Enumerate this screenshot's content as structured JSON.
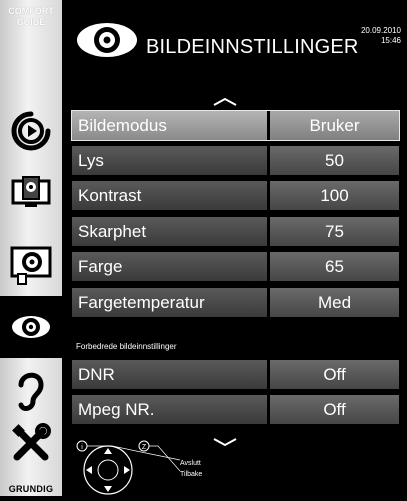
{
  "sidebar": {
    "comfort_guide_label_1": "COMFORT",
    "comfort_guide_label_2": "GUIDE",
    "brand": "GRUNDIG",
    "icons": [
      "play-source-icon",
      "tv-settings-icon",
      "install-icon",
      "picture-eye-icon",
      "sound-ear-icon",
      "tools-icon"
    ],
    "active_icon": "picture-eye-icon"
  },
  "header": {
    "title": "BILDEINNSTILLINGER",
    "date": "20.09.2010",
    "time": "15:46",
    "icon": "eye-icon"
  },
  "menu": {
    "rows": [
      {
        "label": "Bildemodus",
        "value": "Bruker",
        "selected": true
      },
      {
        "label": "Lys",
        "value": "50",
        "selected": false
      },
      {
        "label": "Kontrast",
        "value": "100",
        "selected": false
      },
      {
        "label": "Skarphet",
        "value": "75",
        "selected": false
      },
      {
        "label": "Farge",
        "value": "65",
        "selected": false
      },
      {
        "label": "Fargetemperatur",
        "value": "Med",
        "selected": false
      }
    ],
    "section_label": "Forbedrede bildeinnstillinger",
    "advanced_rows": [
      {
        "label": "DNR",
        "value": "Off"
      },
      {
        "label": "Mpeg NR.",
        "value": "Off"
      }
    ]
  },
  "footer": {
    "exit_label": "Avslutt",
    "back_label": "Tilbake",
    "exit_key": "i",
    "back_key": "Z"
  },
  "colors": {
    "background": "#000000",
    "sidebar": "#e6e6e6",
    "row_label": "#4a4a4a",
    "row_value": "#5a5a5a",
    "selected": "#9e9e9e"
  }
}
